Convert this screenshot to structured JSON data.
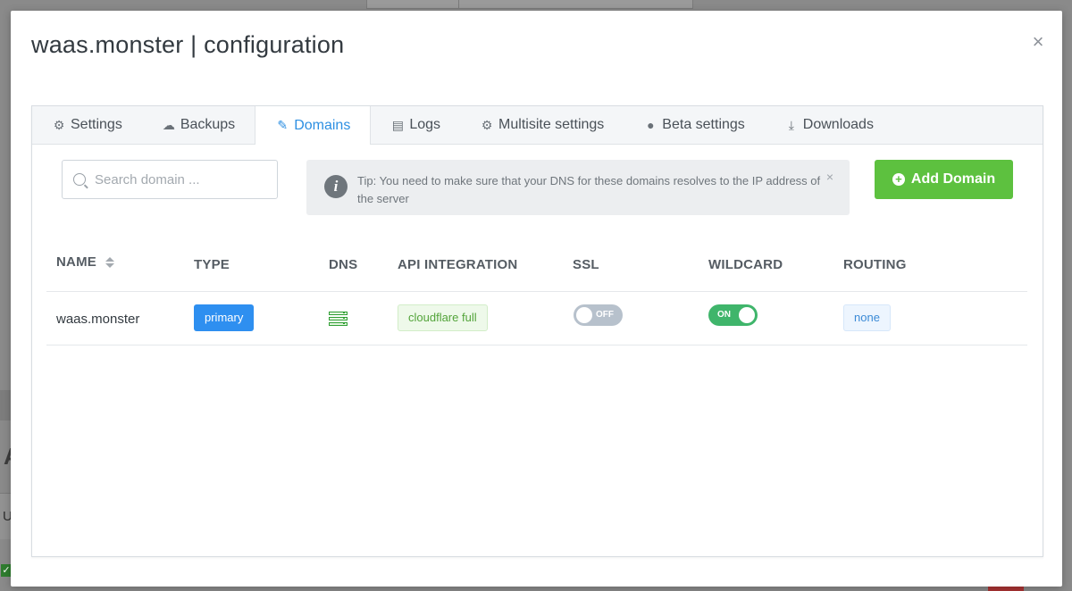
{
  "modal": {
    "title": "waas.monster | configuration",
    "close_icon": "×"
  },
  "tabs": [
    {
      "label": "Settings",
      "icon": "gear-icon",
      "glyph": "⚙",
      "active": false
    },
    {
      "label": "Backups",
      "icon": "cloud-icon",
      "glyph": "☁",
      "active": false
    },
    {
      "label": "Domains",
      "icon": "edit-icon",
      "glyph": "✎",
      "active": true
    },
    {
      "label": "Logs",
      "icon": "document-icon",
      "glyph": "▤",
      "active": false
    },
    {
      "label": "Multisite settings",
      "icon": "gear-icon",
      "glyph": "⚙",
      "active": false
    },
    {
      "label": "Beta settings",
      "icon": "alert-circle-icon",
      "glyph": "●",
      "active": false
    },
    {
      "label": "Downloads",
      "icon": "download-icon",
      "glyph": "⤓",
      "active": false
    }
  ],
  "search": {
    "placeholder": "Search domain ...",
    "value": ""
  },
  "tip": {
    "icon": "i",
    "text": "Tip: You need to make sure that your DNS for these domains resolves to the IP address of the server",
    "close": "×"
  },
  "add_button": {
    "label": "Add Domain",
    "icon": "+"
  },
  "table": {
    "columns": [
      "NAME",
      "TYPE",
      "DNS",
      "API INTEGRATION",
      "SSL",
      "WILDCARD",
      "ROUTING"
    ],
    "rows": [
      {
        "name": "waas.monster",
        "type": "primary",
        "dns_icon": "server-icon",
        "api_integration": "cloudflare full",
        "ssl": "OFF",
        "wildcard": "ON",
        "routing": "none"
      }
    ]
  },
  "colors": {
    "accent": "#2d8fe2",
    "success": "#5dc13f",
    "toggle_on": "#3fb56b",
    "toggle_off": "#b7c1cc"
  },
  "background": {
    "letter_a": "A",
    "letter_u": "U",
    "check": "✓"
  }
}
